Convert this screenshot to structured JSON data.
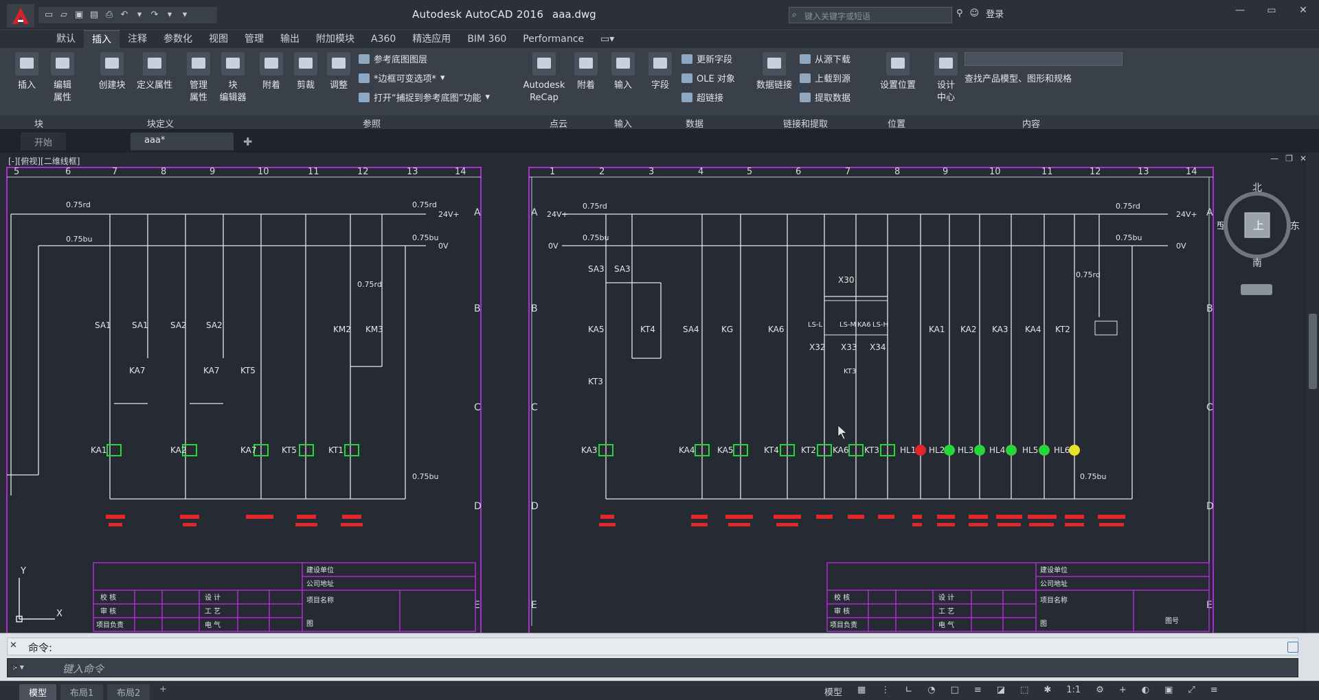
{
  "app": {
    "title": "Autodesk AutoCAD 2016",
    "file": "aaa.dwg",
    "search_placeholder": "键入关键字或短语",
    "login": "登录"
  },
  "menu": {
    "tabs": [
      "默认",
      "插入",
      "注释",
      "参数化",
      "视图",
      "管理",
      "输出",
      "附加模块",
      "A360",
      "精选应用",
      "BIM 360",
      "Performance"
    ]
  },
  "ribbon": {
    "block_panel": {
      "insert": "插入",
      "edit_attr": "编辑\n属性",
      "create_block": "创建块",
      "define_attr": "定义属性",
      "manage_attr": "管理\n属性",
      "block_editor": "块\n编辑器"
    },
    "reference": {
      "attach": "附着",
      "clip": "剪裁",
      "adjust": "调整",
      "underlay_layers": "参考底图图层",
      "frames": "*边框可变选项*",
      "snap": "打开“捕捉到参考底图”功能"
    },
    "pointcloud": {
      "recap": "Autodesk\nReCap",
      "attach": "附着"
    },
    "import": {
      "import": "输入"
    },
    "data": {
      "field": "字段",
      "update_fields": "更新字段",
      "ole": "OLE 对象",
      "hyperlink": "超链接"
    },
    "linking": {
      "data_link": "数据链接",
      "download": "从源下载",
      "upload": "上载到源",
      "extract": "提取数据"
    },
    "location": {
      "set_location": "设置位置"
    },
    "content": {
      "design_center": "设计\n中心",
      "search_label": "查找产品模型、图形和规格"
    },
    "panel_labels": [
      "块",
      "块定义",
      "参照",
      "点云",
      "输入",
      "数据",
      "链接和提取",
      "位置",
      "内容"
    ]
  },
  "filetabs": {
    "start": "开始",
    "current": "aaa*"
  },
  "viewport": {
    "label": "[-][俯视][二维线框]"
  },
  "viewcube": {
    "north": "北",
    "south": "南",
    "east": "东",
    "west": "西",
    "top": "上"
  },
  "drawing": {
    "left_cols": [
      "5",
      "6",
      "7",
      "8",
      "9",
      "10",
      "11",
      "12",
      "13",
      "14"
    ],
    "right_cols": [
      "1",
      "2",
      "3",
      "4",
      "5",
      "6",
      "7",
      "8",
      "9",
      "10",
      "11",
      "12",
      "13",
      "14"
    ],
    "rows": [
      "A",
      "B",
      "C",
      "D",
      "E"
    ],
    "wire_red": "0.75rd",
    "wire_blue": "0.75bu",
    "v24": "24V+",
    "v0": "0V",
    "left_switches": [
      "SA1",
      "SA1",
      "SA2",
      "SA2",
      "KM2",
      "KM3"
    ],
    "left_relays": [
      "KA7",
      "KA7",
      "KT5"
    ],
    "left_coils": [
      "KA1",
      "KA2",
      "KA7",
      "KT5",
      "KT1"
    ],
    "right_switches": [
      "SA3",
      "SA3",
      "KA5",
      "KT4",
      "SA4",
      "KG",
      "KA6",
      "KA1",
      "KA2",
      "KA3",
      "KA4",
      "KT2"
    ],
    "right_misc": [
      "KT3",
      "X30",
      "X32",
      "X33",
      "X34",
      "LS-L",
      "LS-M",
      "KA6",
      "LS-H",
      "KT3"
    ],
    "right_coils": [
      "KA3",
      "KA4",
      "KA5",
      "KT4",
      "KT2",
      "KA6",
      "KT3"
    ],
    "lamps": [
      "HL1",
      "HL2",
      "HL3",
      "HL4",
      "HL5",
      "HL6"
    ],
    "title_block": {
      "company": "建设单位",
      "address": "公司地址",
      "project": "项目名称",
      "rows_left": [
        "校 核",
        "审 核",
        "项目负责"
      ],
      "rows_mid": [
        "设 计",
        "工 艺",
        "电 气"
      ],
      "figure": "图",
      "drawing_no": "图号"
    }
  },
  "command": {
    "history": "命令:",
    "placeholder": "键入命令"
  },
  "status": {
    "tabs": [
      "模型",
      "布局1",
      "布局2"
    ],
    "model": "模型",
    "scale": "1:1"
  }
}
